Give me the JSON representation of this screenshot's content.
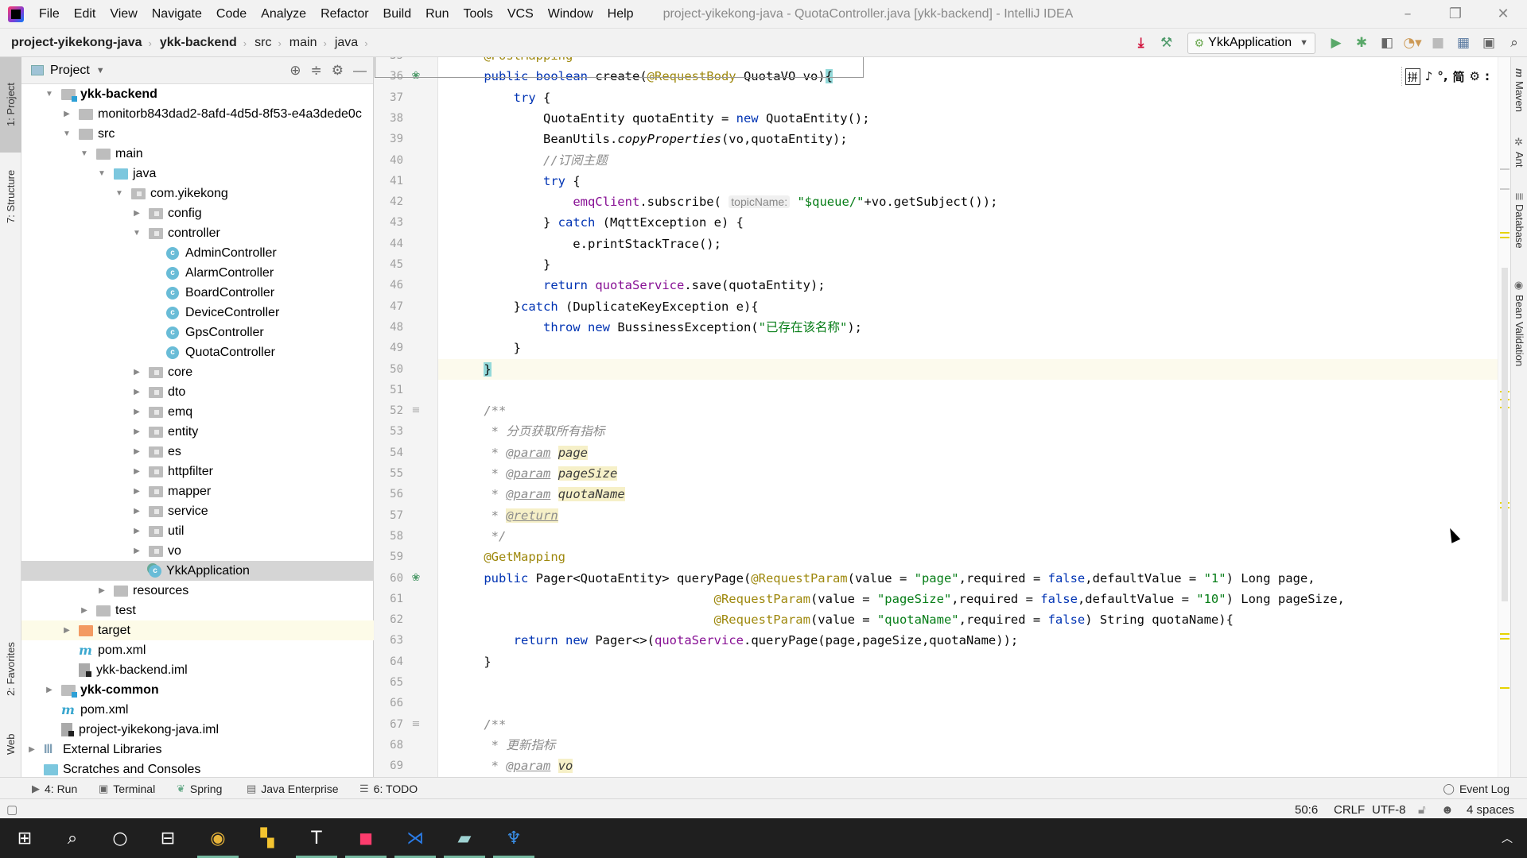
{
  "window": {
    "title": "project-yikekong-java - QuotaController.java [ykk-backend] - IntelliJ IDEA",
    "controls": [
      "minimize",
      "restore",
      "close"
    ]
  },
  "menu": [
    "File",
    "Edit",
    "View",
    "Navigate",
    "Code",
    "Analyze",
    "Refactor",
    "Build",
    "Run",
    "Tools",
    "VCS",
    "Window",
    "Help"
  ],
  "breadcrumb": [
    "project-yikekong-java",
    "ykk-backend",
    "src",
    "main",
    "java"
  ],
  "run_toolbar": {
    "config": "YkkApplication",
    "icons": [
      "update-icon",
      "build-hammer-icon",
      "run-icon",
      "debug-icon",
      "coverage-icon",
      "profile-icon",
      "stop-icon",
      "project-structure-icon",
      "presentation-icon",
      "search-icon"
    ]
  },
  "left_stripe": [
    "1: Project",
    "7: Structure",
    "2: Favorites",
    "Web"
  ],
  "right_stripe": [
    "Maven",
    "Ant",
    "Database",
    "Bean Validation"
  ],
  "project_panel": {
    "title": "Project",
    "tree": [
      {
        "label": "ykk-backend",
        "level": 1,
        "type": "module",
        "expanded": true,
        "bold": true
      },
      {
        "label": "monitorb843dad2-8afd-4d5d-8f53-e4a3dede0c",
        "level": 2,
        "type": "folder",
        "expanded": false
      },
      {
        "label": "src",
        "level": 2,
        "type": "folder",
        "expanded": true
      },
      {
        "label": "main",
        "level": 3,
        "type": "folder",
        "expanded": true
      },
      {
        "label": "java",
        "level": 4,
        "type": "src",
        "expanded": true
      },
      {
        "label": "com.yikekong",
        "level": 5,
        "type": "package",
        "expanded": true
      },
      {
        "label": "config",
        "level": 6,
        "type": "package",
        "expanded": false
      },
      {
        "label": "controller",
        "level": 6,
        "type": "package",
        "expanded": true
      },
      {
        "label": "AdminController",
        "level": 7,
        "type": "class"
      },
      {
        "label": "AlarmController",
        "level": 7,
        "type": "class"
      },
      {
        "label": "BoardController",
        "level": 7,
        "type": "class"
      },
      {
        "label": "DeviceController",
        "level": 7,
        "type": "class"
      },
      {
        "label": "GpsController",
        "level": 7,
        "type": "class"
      },
      {
        "label": "QuotaController",
        "level": 7,
        "type": "class"
      },
      {
        "label": "core",
        "level": 6,
        "type": "package",
        "expanded": false
      },
      {
        "label": "dto",
        "level": 6,
        "type": "package",
        "expanded": false
      },
      {
        "label": "emq",
        "level": 6,
        "type": "package",
        "expanded": false
      },
      {
        "label": "entity",
        "level": 6,
        "type": "package",
        "expanded": false
      },
      {
        "label": "es",
        "level": 6,
        "type": "package",
        "expanded": false
      },
      {
        "label": "httpfilter",
        "level": 6,
        "type": "package",
        "expanded": false
      },
      {
        "label": "mapper",
        "level": 6,
        "type": "package",
        "expanded": false
      },
      {
        "label": "service",
        "level": 6,
        "type": "package",
        "expanded": false
      },
      {
        "label": "util",
        "level": 6,
        "type": "package",
        "expanded": false
      },
      {
        "label": "vo",
        "level": 6,
        "type": "package",
        "expanded": false
      },
      {
        "label": "YkkApplication",
        "level": 6,
        "type": "springclass",
        "selected": true
      },
      {
        "label": "resources",
        "level": 4,
        "type": "folder",
        "expanded": false
      },
      {
        "label": "test",
        "level": 3,
        "type": "folder",
        "expanded": false
      },
      {
        "label": "target",
        "level": 2,
        "type": "excluded",
        "expanded": false,
        "highlight": true
      },
      {
        "label": "pom.xml",
        "level": 2,
        "type": "maven"
      },
      {
        "label": "ykk-backend.iml",
        "level": 2,
        "type": "iml"
      },
      {
        "label": "ykk-common",
        "level": 1,
        "type": "module",
        "expanded": false,
        "bold": true
      },
      {
        "label": "pom.xml",
        "level": 1,
        "type": "maven"
      },
      {
        "label": "project-yikekong-java.iml",
        "level": 1,
        "type": "iml"
      },
      {
        "label": "External Libraries",
        "level": 0,
        "type": "libs",
        "expanded": false
      },
      {
        "label": "Scratches and Consoles",
        "level": 0,
        "type": "scratch"
      }
    ]
  },
  "editor": {
    "file": "QuotaController.java",
    "caret": "50:6",
    "lines": [
      {
        "n": 35,
        "tokens": [
          [
            "    ",
            ""
          ],
          [
            "@PostMapping",
            "an"
          ]
        ]
      },
      {
        "n": 36,
        "icon": "spring-bean",
        "tokens": [
          [
            "    ",
            ""
          ],
          [
            "public",
            "kw"
          ],
          [
            " ",
            ""
          ],
          [
            "boolean",
            "kw"
          ],
          [
            " create(",
            ""
          ],
          [
            "@RequestBody",
            "an"
          ],
          [
            " QuotaVO vo)",
            ""
          ],
          [
            "{",
            "brace-match"
          ]
        ]
      },
      {
        "n": 37,
        "tokens": [
          [
            "        ",
            ""
          ],
          [
            "try",
            "kw"
          ],
          [
            " {",
            ""
          ]
        ]
      },
      {
        "n": 38,
        "tokens": [
          [
            "            QuotaEntity quotaEntity = ",
            ""
          ],
          [
            "new",
            "kw"
          ],
          [
            " QuotaEntity();",
            ""
          ]
        ]
      },
      {
        "n": 39,
        "tokens": [
          [
            "            BeanUtils.",
            ""
          ],
          [
            "copyProperties",
            "it"
          ],
          [
            "(vo,quotaEntity);",
            ""
          ]
        ]
      },
      {
        "n": 40,
        "tokens": [
          [
            "            ",
            ""
          ],
          [
            "//订阅主题",
            "cmt"
          ]
        ]
      },
      {
        "n": 41,
        "tokens": [
          [
            "            ",
            ""
          ],
          [
            "try",
            "kw"
          ],
          [
            " {",
            ""
          ]
        ]
      },
      {
        "n": 42,
        "tokens": [
          [
            "                ",
            ""
          ],
          [
            "emqClient",
            "fld"
          ],
          [
            ".subscribe( ",
            ""
          ],
          [
            "topicName:",
            "hint"
          ],
          [
            " ",
            ""
          ],
          [
            "\"$queue/\"",
            "str"
          ],
          [
            "+vo.getSubject());",
            ""
          ]
        ]
      },
      {
        "n": 43,
        "tokens": [
          [
            "            } ",
            ""
          ],
          [
            "catch",
            "kw"
          ],
          [
            " (MqttException e) {",
            ""
          ]
        ]
      },
      {
        "n": 44,
        "tokens": [
          [
            "                e.printStackTrace();",
            ""
          ]
        ]
      },
      {
        "n": 45,
        "tokens": [
          [
            "            }",
            ""
          ]
        ]
      },
      {
        "n": 46,
        "tokens": [
          [
            "            ",
            ""
          ],
          [
            "return",
            "kw"
          ],
          [
            " ",
            ""
          ],
          [
            "quotaService",
            "fld"
          ],
          [
            ".save(quotaEntity);",
            ""
          ]
        ]
      },
      {
        "n": 47,
        "tokens": [
          [
            "        }",
            ""
          ],
          [
            "catch",
            "kw"
          ],
          [
            " (DuplicateKeyException e){",
            ""
          ]
        ]
      },
      {
        "n": 48,
        "tokens": [
          [
            "            ",
            ""
          ],
          [
            "throw",
            "kw"
          ],
          [
            " ",
            ""
          ],
          [
            "new",
            "kw"
          ],
          [
            " BussinessException(",
            ""
          ],
          [
            "\"已存在该名称\"",
            "str"
          ],
          [
            ");",
            ""
          ]
        ]
      },
      {
        "n": 49,
        "tokens": [
          [
            "        }",
            ""
          ]
        ]
      },
      {
        "n": 50,
        "current": true,
        "tokens": [
          [
            "    ",
            ""
          ],
          [
            "}",
            "brace-match"
          ]
        ]
      },
      {
        "n": 51,
        "tokens": []
      },
      {
        "n": 52,
        "icon": "doc",
        "tokens": [
          [
            "    ",
            ""
          ],
          [
            "/**",
            "cmt"
          ]
        ]
      },
      {
        "n": 53,
        "tokens": [
          [
            "     ",
            ""
          ],
          [
            "* 分页获取所有指标",
            "cmt"
          ]
        ]
      },
      {
        "n": 54,
        "tokens": [
          [
            "     ",
            ""
          ],
          [
            "* ",
            "cmt"
          ],
          [
            "@param",
            "doctag"
          ],
          [
            " ",
            ""
          ],
          [
            "page",
            "docparam"
          ]
        ]
      },
      {
        "n": 55,
        "tokens": [
          [
            "     ",
            ""
          ],
          [
            "* ",
            "cmt"
          ],
          [
            "@param",
            "doctag"
          ],
          [
            " ",
            ""
          ],
          [
            "pageSize",
            "docparam"
          ]
        ]
      },
      {
        "n": 56,
        "tokens": [
          [
            "     ",
            ""
          ],
          [
            "* ",
            "cmt"
          ],
          [
            "@param",
            "doctag"
          ],
          [
            " ",
            ""
          ],
          [
            "quotaName",
            "docparam"
          ]
        ]
      },
      {
        "n": 57,
        "tokens": [
          [
            "     ",
            ""
          ],
          [
            "* ",
            "cmt"
          ],
          [
            "@return",
            "doctag docret-bg"
          ]
        ]
      },
      {
        "n": 58,
        "tokens": [
          [
            "     ",
            ""
          ],
          [
            "*/",
            "cmt"
          ]
        ]
      },
      {
        "n": 59,
        "tokens": [
          [
            "    ",
            ""
          ],
          [
            "@GetMapping",
            "an"
          ]
        ]
      },
      {
        "n": 60,
        "icon": "spring-bean",
        "tokens": [
          [
            "    ",
            ""
          ],
          [
            "public",
            "kw"
          ],
          [
            " Pager<QuotaEntity> queryPage(",
            ""
          ],
          [
            "@RequestParam",
            "an"
          ],
          [
            "(value = ",
            ""
          ],
          [
            "\"page\"",
            "str"
          ],
          [
            ",required = ",
            ""
          ],
          [
            "false",
            "kw"
          ],
          [
            ",defaultValue = ",
            ""
          ],
          [
            "\"1\"",
            "str"
          ],
          [
            ") Long page,",
            ""
          ]
        ]
      },
      {
        "n": 61,
        "tokens": [
          [
            "                                   ",
            ""
          ],
          [
            "@RequestParam",
            "an"
          ],
          [
            "(value = ",
            ""
          ],
          [
            "\"pageSize\"",
            "str"
          ],
          [
            ",required = ",
            ""
          ],
          [
            "false",
            "kw"
          ],
          [
            ",defaultValue = ",
            ""
          ],
          [
            "\"10\"",
            "str"
          ],
          [
            ") Long pageSize,",
            ""
          ]
        ]
      },
      {
        "n": 62,
        "tokens": [
          [
            "                                   ",
            ""
          ],
          [
            "@RequestParam",
            "an"
          ],
          [
            "(value = ",
            ""
          ],
          [
            "\"quotaName\"",
            "str"
          ],
          [
            ",required = ",
            ""
          ],
          [
            "false",
            "kw"
          ],
          [
            ") String quotaName){",
            ""
          ]
        ]
      },
      {
        "n": 63,
        "tokens": [
          [
            "        ",
            ""
          ],
          [
            "return",
            "kw"
          ],
          [
            " ",
            ""
          ],
          [
            "new",
            "kw"
          ],
          [
            " Pager<>(",
            ""
          ],
          [
            "quotaService",
            "fld"
          ],
          [
            ".queryPage(page,pageSize,quotaName));",
            ""
          ]
        ]
      },
      {
        "n": 64,
        "tokens": [
          [
            "    }",
            ""
          ]
        ]
      },
      {
        "n": 65,
        "tokens": []
      },
      {
        "n": 66,
        "tokens": []
      },
      {
        "n": 67,
        "icon": "doc",
        "tokens": [
          [
            "    ",
            ""
          ],
          [
            "/**",
            "cmt"
          ]
        ]
      },
      {
        "n": 68,
        "tokens": [
          [
            "     ",
            ""
          ],
          [
            "* 更新指标",
            "cmt"
          ]
        ]
      },
      {
        "n": 69,
        "tokens": [
          [
            "     ",
            ""
          ],
          [
            "* ",
            "cmt"
          ],
          [
            "@param",
            "doctag"
          ],
          [
            " ",
            ""
          ],
          [
            "vo",
            "docparam"
          ]
        ]
      }
    ]
  },
  "ime_bar": [
    "拼",
    "♪",
    "°,",
    "简",
    "⚙",
    ":"
  ],
  "bottom_tools": [
    {
      "label": "4: Run",
      "icon": "run-icon"
    },
    {
      "label": "Terminal",
      "icon": "terminal-icon"
    },
    {
      "label": "Spring",
      "icon": "spring-icon"
    },
    {
      "label": "Java Enterprise",
      "icon": "java-enterprise-icon"
    },
    {
      "label": "6: TODO",
      "icon": "todo-icon"
    }
  ],
  "event_log": "Event Log",
  "status": {
    "position": "50:6",
    "line_sep": "CRLF",
    "encoding": "UTF-8",
    "indent": "4 spaces"
  },
  "taskbar": [
    "start",
    "search",
    "cortana",
    "task-view",
    "chrome",
    "app-store",
    "typora",
    "intellij",
    "vscode",
    "notes",
    "dbeaver"
  ],
  "colors": {
    "keyword": "#0033b3",
    "annotation": "#9e880d",
    "string": "#067d17",
    "field": "#871094",
    "comment": "#8c8c8c"
  }
}
